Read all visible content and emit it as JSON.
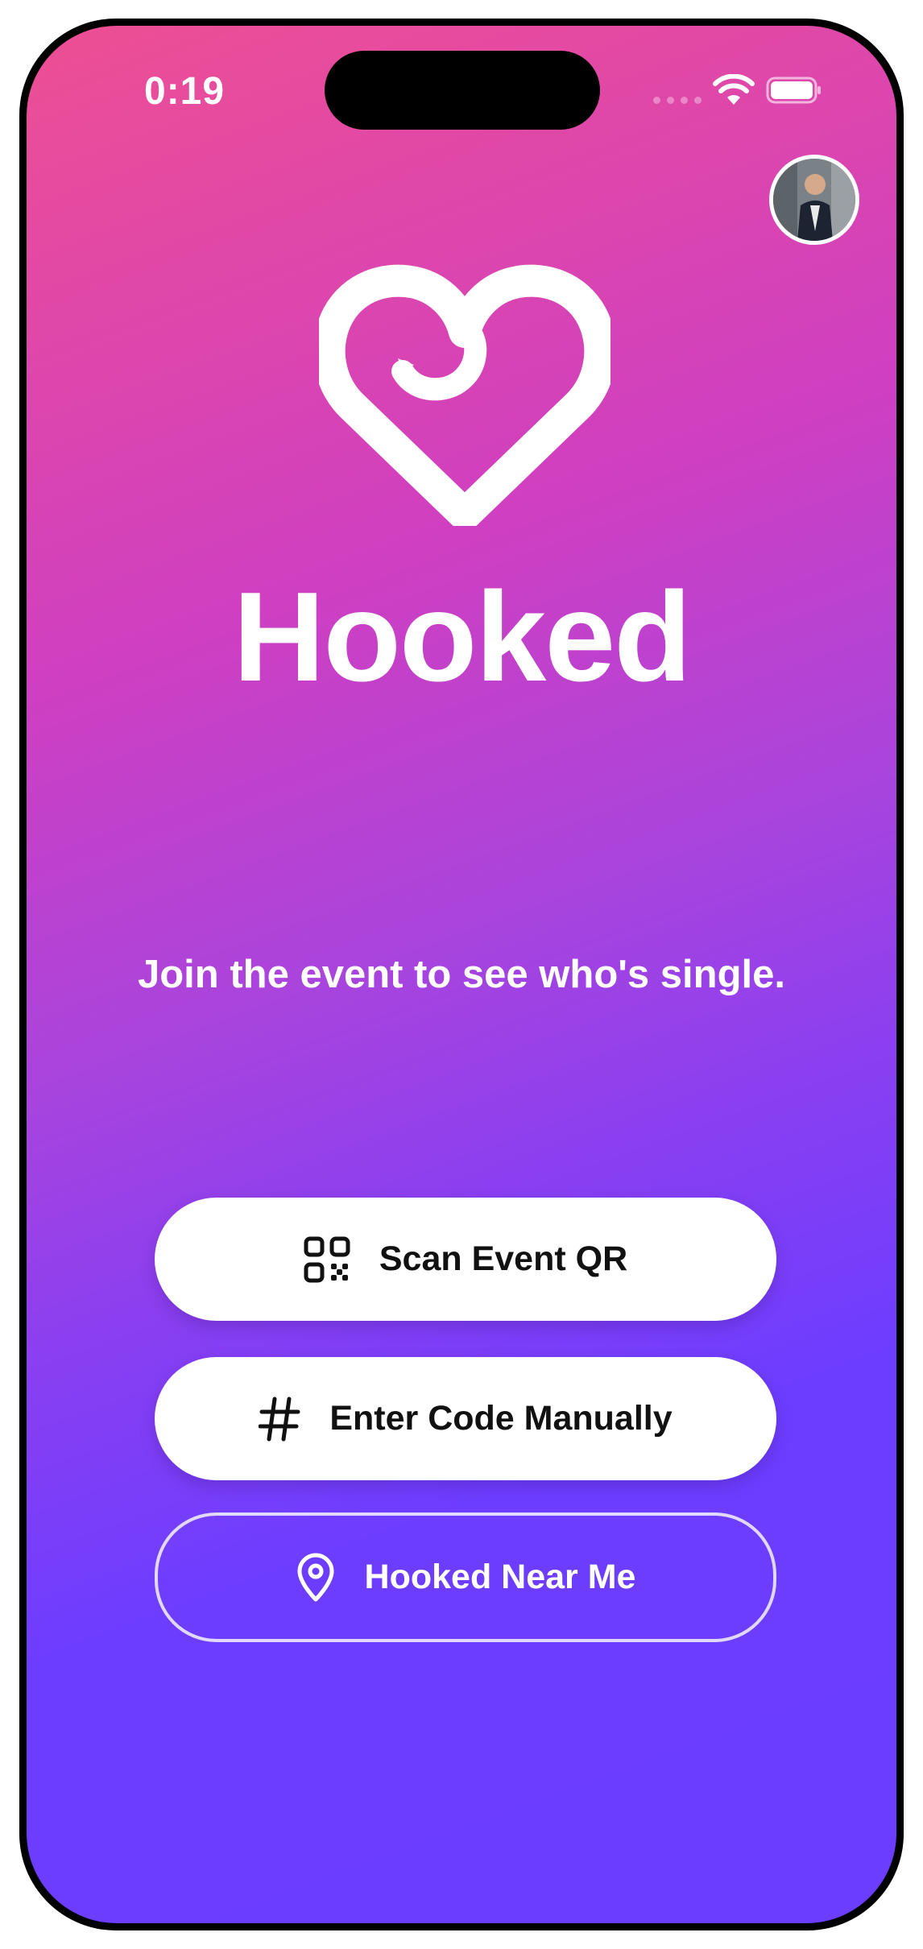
{
  "status_bar": {
    "time": "0:19",
    "icons": [
      "cellular-signal-icon",
      "wifi-icon",
      "battery-icon"
    ]
  },
  "profile": {
    "avatar_icon": "profile-avatar"
  },
  "brand": {
    "logo_icon": "heart-hook-logo-icon",
    "app_name": "Hooked"
  },
  "tagline": "Join the event to see who's single.",
  "actions": {
    "scan_qr": {
      "label": "Scan Event QR",
      "icon": "qr-code-icon"
    },
    "enter_code": {
      "label": "Enter Code Manually",
      "icon": "hashtag-icon"
    },
    "near_me": {
      "label": "Hooked Near Me",
      "icon": "location-pin-icon"
    }
  },
  "colors": {
    "gradient_top": "#ee4f93",
    "gradient_mid": "#cf3fc1",
    "gradient_bottom": "#6a3dff",
    "button_bg": "#ffffff",
    "text_on_button": "#111111"
  }
}
